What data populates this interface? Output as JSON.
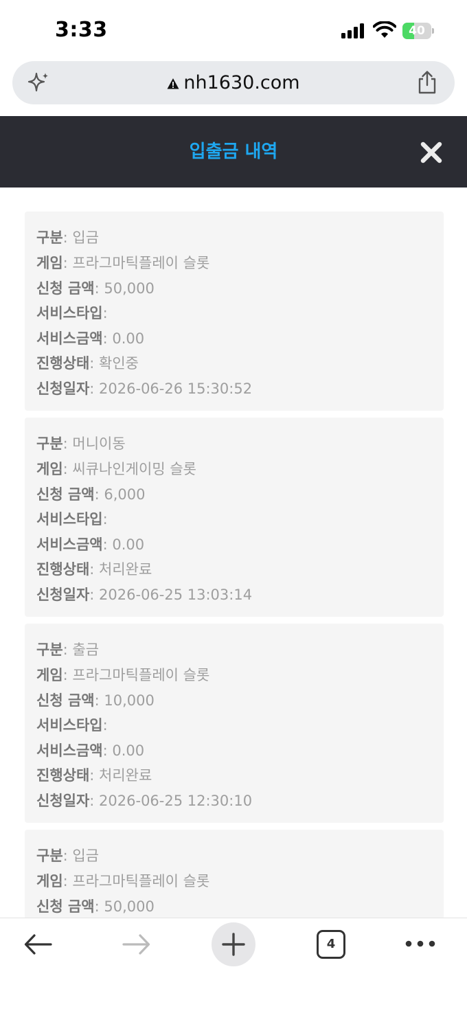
{
  "status_bar": {
    "time": "3:33",
    "battery_level": 40,
    "battery_color": "#4cd964"
  },
  "browser": {
    "url": "nh1630.com",
    "left_icon": "sparkle-icon",
    "right_icon": "share-icon",
    "toolbar": {
      "tab_count": "4",
      "back_icon": "arrow-left-icon",
      "forward_icon": "arrow-right-icon",
      "new_tab_icon": "plus-icon",
      "more_icon": "more-dots-icon"
    }
  },
  "header": {
    "title": "입출금 내역",
    "title_color": "#1ea7f0",
    "background": "#2b2c33",
    "close_icon": "close-icon"
  },
  "records": [
    {
      "type_label": "구분",
      "type": "입금",
      "game_label": "게임",
      "game": "프라그마틱플레이 슬롯",
      "amount_label": "신청 금액",
      "amount": "50,000",
      "service_type_label": "서비스타입",
      "service_type": "",
      "service_amount_label": "서비스금액",
      "service_amount": "0.00",
      "status_label": "진행상태",
      "status": "확인중",
      "date_label": "신청일자",
      "date": "2026-06-26 15:30:52"
    },
    {
      "type_label": "구분",
      "type": "머니이동",
      "game_label": "게임",
      "game": "씨큐나인게이밍 슬롯",
      "amount_label": "신청 금액",
      "amount": "6,000",
      "service_type_label": "서비스타입",
      "service_type": "",
      "service_amount_label": "서비스금액",
      "service_amount": "0.00",
      "status_label": "진행상태",
      "status": "처리완료",
      "date_label": "신청일자",
      "date": "2026-06-25 13:03:14"
    },
    {
      "type_label": "구분",
      "type": "출금",
      "game_label": "게임",
      "game": "프라그마틱플레이 슬롯",
      "amount_label": "신청 금액",
      "amount": "10,000",
      "service_type_label": "서비스타입",
      "service_type": "",
      "service_amount_label": "서비스금액",
      "service_amount": "0.00",
      "status_label": "진행상태",
      "status": "처리완료",
      "date_label": "신청일자",
      "date": "2026-06-25 12:30:10"
    },
    {
      "type_label": "구분",
      "type": "입금",
      "game_label": "게임",
      "game": "프라그마틱플레이 슬롯",
      "amount_label": "신청 금액",
      "amount": "50,000"
    }
  ]
}
